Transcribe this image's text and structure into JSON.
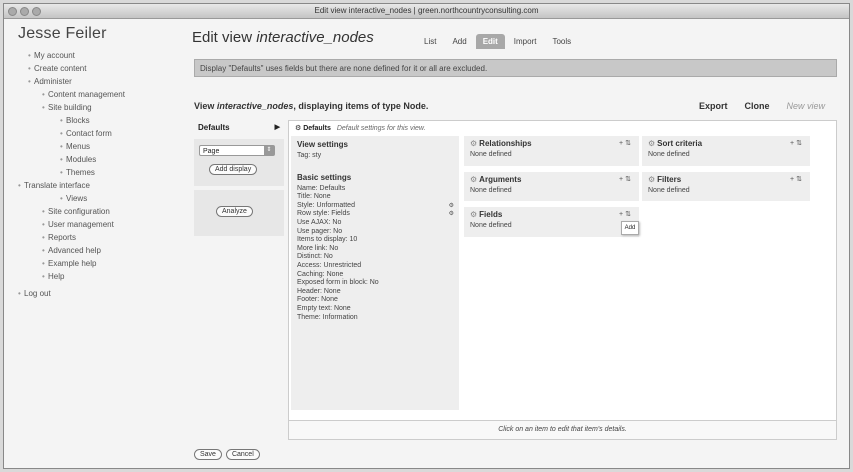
{
  "window": {
    "title": "Edit view interactive_nodes | green.northcountryconsulting.com"
  },
  "site": {
    "name": "Jesse Feiler"
  },
  "sidebar": {
    "items": [
      {
        "label": "My account",
        "level": 1
      },
      {
        "label": "Create content",
        "level": 1
      },
      {
        "label": "Administer",
        "level": 1
      },
      {
        "label": "Content management",
        "level": 2
      },
      {
        "label": "Site building",
        "level": 2
      },
      {
        "label": "Blocks",
        "level": 3
      },
      {
        "label": "Contact form",
        "level": 3
      },
      {
        "label": "Menus",
        "level": 3
      },
      {
        "label": "Modules",
        "level": 3
      },
      {
        "label": "Themes",
        "level": 3
      },
      {
        "label": "Translate interface",
        "level": 4
      },
      {
        "label": "Views",
        "level": 3
      },
      {
        "label": "Site configuration",
        "level": 2
      },
      {
        "label": "User management",
        "level": 2
      },
      {
        "label": "Reports",
        "level": 2
      },
      {
        "label": "Advanced help",
        "level": 2
      },
      {
        "label": "Example help",
        "level": 2
      },
      {
        "label": "Help",
        "level": 2
      },
      {
        "label": "Log out",
        "level": 0
      }
    ]
  },
  "page": {
    "title_prefix": "Edit view ",
    "title_name": "interactive_nodes",
    "tabs": [
      "List",
      "Add",
      "Edit",
      "Import",
      "Tools"
    ],
    "active_tab": "Edit",
    "notice": "Display \"Defaults\" uses fields but there are none defined for it or all are excluded."
  },
  "view": {
    "heading_prefix": "View ",
    "heading_name": "interactive_nodes",
    "heading_suffix": ", displaying items of type Node.",
    "actions": [
      "Export",
      "Clone",
      "New view"
    ]
  },
  "displays": {
    "defaults_label": "Defaults",
    "select_value": "Page",
    "add_display_label": "Add display",
    "analyze_label": "Analyze"
  },
  "panel": {
    "head_title": "Defaults",
    "head_desc": "Default settings for this view.",
    "view_settings": {
      "title": "View settings",
      "lines": [
        "Tag: sty"
      ]
    },
    "basic_settings": {
      "title": "Basic settings",
      "lines": [
        "Name: Defaults",
        "Title: None",
        "Style: Unformatted",
        "Row style: Fields",
        "Use AJAX: No",
        "Use pager: No",
        "Items to display: 10",
        "More link: No",
        "Distinct: No",
        "Access: Unrestricted",
        "Caching: None",
        "Exposed form in block: No",
        "Header: None",
        "Footer: None",
        "Empty text: None",
        "Theme: Information"
      ]
    },
    "relationships": {
      "title": "Relationships",
      "value": "None defined"
    },
    "arguments": {
      "title": "Arguments",
      "value": "None defined"
    },
    "fields": {
      "title": "Fields",
      "value": "None defined",
      "tooltip": "Add"
    },
    "sort_criteria": {
      "title": "Sort criteria",
      "value": "None defined"
    },
    "filters": {
      "title": "Filters",
      "value": "None defined"
    },
    "footer_hint": "Click on an item to edit that item's details."
  },
  "form": {
    "save_label": "Save",
    "cancel_label": "Cancel"
  }
}
